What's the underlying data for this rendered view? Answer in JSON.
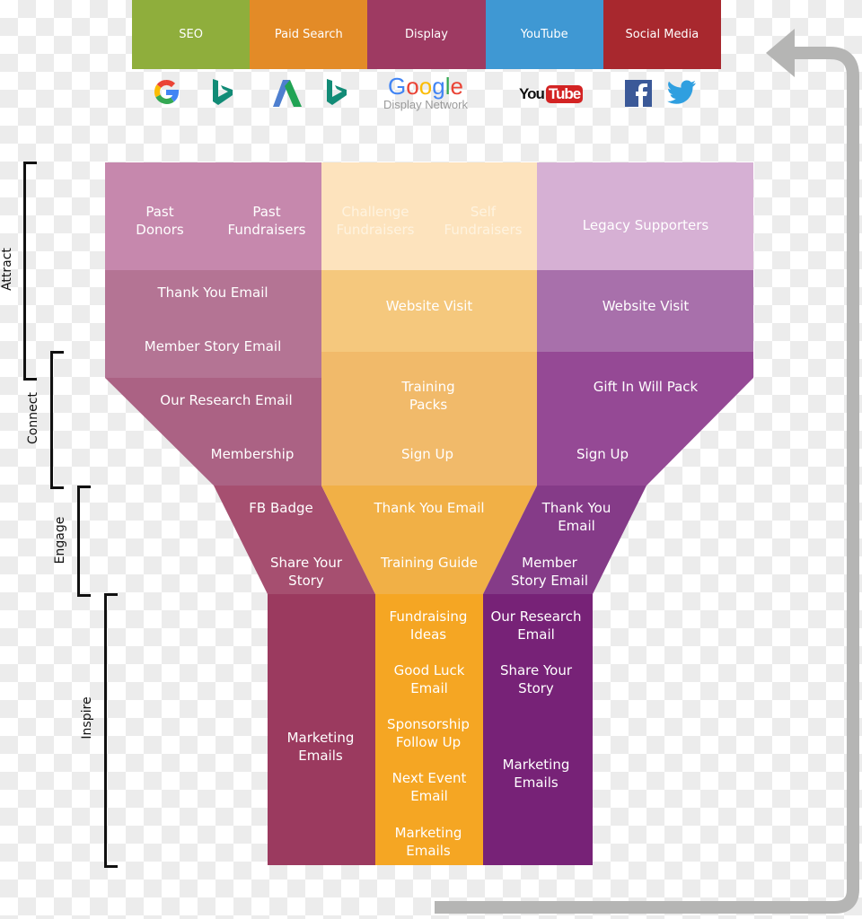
{
  "channels": [
    {
      "label": "SEO",
      "color": "#8fae3c"
    },
    {
      "label": "Paid Search",
      "color": "#e38b27"
    },
    {
      "label": "Display",
      "color": "#9e3a62"
    },
    {
      "label": "YouTube",
      "color": "#3f98d3"
    },
    {
      "label": "Social Media",
      "color": "#a8282e"
    }
  ],
  "channel_icons": {
    "seo": [
      "google-icon",
      "bing-icon"
    ],
    "paid_search": [
      "google-ads-icon",
      "bing-icon"
    ],
    "display": {
      "google_text": "Google",
      "network_text": "Display Network"
    },
    "youtube": {
      "you": "You",
      "tube": "Tube"
    },
    "social": [
      "facebook-icon",
      "twitter-icon"
    ]
  },
  "stages": [
    {
      "label": "Attract"
    },
    {
      "label": "Connect"
    },
    {
      "label": "Engage"
    },
    {
      "label": "Inspire"
    }
  ],
  "funnel": {
    "attract_segments": {
      "left": [
        "Past\nDonors",
        "Past\nFundraisers"
      ],
      "middle": [
        "Challenge\nFundraisers",
        "Self\nFundraisers"
      ],
      "right": [
        "Legacy Supporters"
      ]
    },
    "rows": {
      "left_thank_you": "Thank You Email",
      "left_member_story": "Member Story Email",
      "mid_website_visit": "Website Visit",
      "right_website_visit": "Website Visit",
      "left_research": "Our Research Email",
      "left_membership": "Membership",
      "mid_training_packs": "Training\nPacks",
      "mid_sign_up": "Sign Up",
      "right_gift_in_will": "Gift In Will Pack",
      "right_sign_up": "Sign Up",
      "left_fb_badge": "FB Badge",
      "left_share_story": "Share Your\nStory",
      "mid_thank_you": "Thank You Email",
      "mid_training_guide": "Training Guide",
      "right_thank_you": "Thank You\nEmail",
      "right_member_story": "Member\nStory Email"
    },
    "inspire": {
      "left": [
        "Marketing\nEmails"
      ],
      "middle": [
        "Fundraising\nIdeas",
        "Good Luck\nEmail",
        "Sponsorship\nFollow Up",
        "Next Event\nEmail",
        "Marketing\nEmails"
      ],
      "right": [
        "Our Research\nEmail",
        "Share Your\nStory",
        "Marketing\nEmails"
      ]
    }
  },
  "colors": {
    "left": [
      "#c688ad",
      "#b47494",
      "#ab6284",
      "#a64f70",
      "#9b3a5f"
    ],
    "middle": [
      "#fde3bd",
      "#f5c87d",
      "#f1ba6a",
      "#f1b046",
      "#f5a623"
    ],
    "right": [
      "#d6b0d4",
      "#a870ab",
      "#954995",
      "#853b88",
      "#772277"
    ],
    "arrow": "#b5b5b4"
  }
}
